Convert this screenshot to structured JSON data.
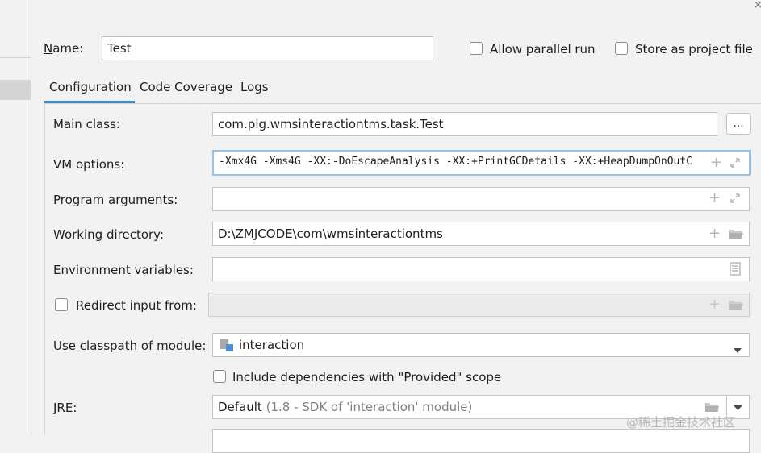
{
  "window": {
    "close_glyph": "×"
  },
  "header": {
    "name_label": "Name:",
    "name_value": "Test",
    "allow_parallel_label": "Allow parallel run",
    "store_project_label": "Store as project file"
  },
  "tabs": [
    {
      "label": "Configuration",
      "active": true
    },
    {
      "label": "Code Coverage",
      "active": false
    },
    {
      "label": "Logs",
      "active": false
    }
  ],
  "form": {
    "main_class_label": "Main class:",
    "main_class_value": "com.plg.wmsinteractiontms.task.Test",
    "browse_label": "...",
    "vm_options_label": "VM options:",
    "vm_options_value": "-Xmx4G -Xms4G -XX:-DoEscapeAnalysis -XX:+PrintGCDetails -XX:+HeapDumpOnOutC",
    "program_args_label": "Program arguments:",
    "program_args_value": "",
    "working_dir_label": "Working directory:",
    "working_dir_value": "D:\\ZMJCODE\\com\\wmsinteractiontms",
    "env_vars_label": "Environment variables:",
    "env_vars_value": "",
    "redirect_label": "Redirect input from:",
    "redirect_value": "",
    "classpath_label": "Use classpath of module:",
    "classpath_value": "interaction",
    "include_deps_label": "Include dependencies with \"Provided\" scope",
    "jre_label": "JRE:",
    "jre_default": "Default",
    "jre_detail": "(1.8 - SDK of 'interaction' module)"
  },
  "icons": {
    "plus": "+",
    "expand": "expand-icon",
    "folder": "folder-icon",
    "document": "document-icon",
    "module": "module-icon",
    "dropdown": "chevron-down-icon"
  },
  "watermark": "@稀土掘金技术社区",
  "colors": {
    "accent": "#4083c9",
    "background": "#f2f2f2",
    "field_border": "#c4c4c4",
    "focus_border": "#97c2e8"
  }
}
